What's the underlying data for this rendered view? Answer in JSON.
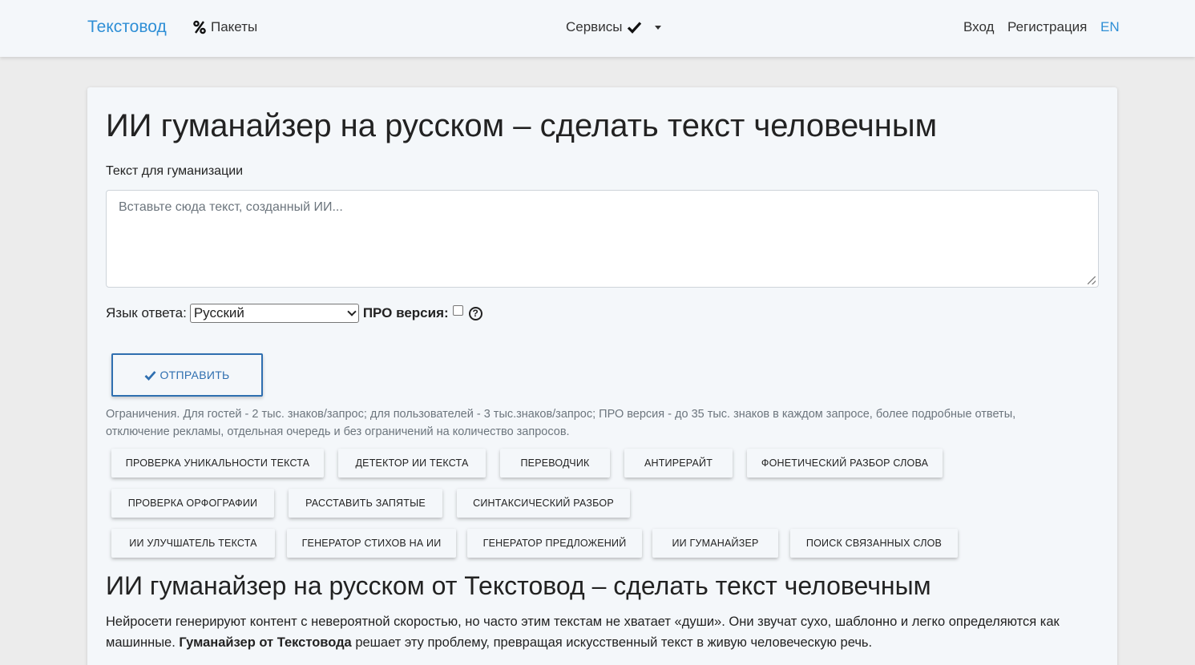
{
  "nav": {
    "brand": "Текстовод",
    "packages": "Пакеты",
    "services": "Сервисы",
    "login": "Вход",
    "register": "Регистрация",
    "lang": "EN"
  },
  "main": {
    "title": "ИИ гуманайзер на русском – сделать текст человечным",
    "field_label": "Текст для гуманизации",
    "textarea_placeholder": "Вставьте сюда текст, созданный ИИ...",
    "lang_label": "Язык ответа:",
    "lang_selected": "Русский",
    "pro_label": "ПРО версия:",
    "help_glyph": "?",
    "submit_label": "ОТПРАВИТЬ",
    "limits": "Ограничения. Для гостей - 2 тыс. знаков/запрос; для пользователей - 3 тыс.знаков/запрос; ПРО версия - до 35 тыс. знаков в каждом запросе, более подробные ответы, отключение рекламы, отдельная очередь и без ограничений на количество запросов."
  },
  "services": [
    "ПРОВЕРКА УНИКАЛЬНОСТИ ТЕКСТА",
    "ДЕТЕКТОР ИИ ТЕКСТА",
    "ПЕРЕВОДЧИК",
    "АНТИРЕРАЙТ",
    "ФОНЕТИЧЕСКИЙ РАЗБОР СЛОВА",
    "ПРОВЕРКА ОРФОГРАФИИ",
    "РАССТАВИТЬ ЗАПЯТЫЕ",
    "СИНТАКСИЧЕСКИЙ РАЗБОР",
    "ИИ УЛУЧШАТЕЛЬ ТЕКСТА",
    "ГЕНЕРАТОР СТИХОВ НА ИИ",
    "ГЕНЕРАТОР ПРЕДЛОЖЕНИЙ",
    "ИИ ГУМАНАЙЗЕР",
    "ПОИСК СВЯЗАННЫХ СЛОВ"
  ],
  "article": {
    "title": "ИИ гуманайзер на русском от Текстовод – сделать текст человечным",
    "p1_start": "Нейросети генерируют контент с невероятной скоростью, но часто этим текстам не хватает «души». Они звучат сухо, шаблонно и легко определяются как машинные. ",
    "p1_bold": "Гуманайзер от Текстовода",
    "p1_end": " решает эту проблему, превращая искусственный текст в живую человеческую речь."
  },
  "colors": {
    "brand": "#2f8fd6",
    "button_border": "#2f6fb0"
  }
}
